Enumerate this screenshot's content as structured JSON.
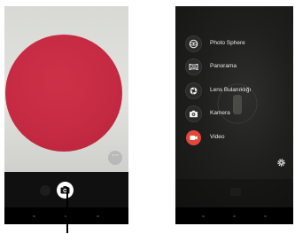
{
  "left_screen": {
    "more_button_label": "···",
    "shutter_icon": "camera-icon",
    "accent_color": "#c42a42"
  },
  "right_screen": {
    "modes": [
      {
        "label": "Photo Sphere",
        "icon": "photo-sphere-icon"
      },
      {
        "label": "Panorama",
        "icon": "panorama-icon"
      },
      {
        "label": "Lens Bulanıklığı",
        "icon": "lens-blur-icon"
      },
      {
        "label": "Kamera",
        "icon": "camera-icon"
      },
      {
        "label": "Video",
        "icon": "video-icon",
        "active": true
      }
    ],
    "settings_icon": "gear-icon",
    "active_color": "#e4463a"
  }
}
